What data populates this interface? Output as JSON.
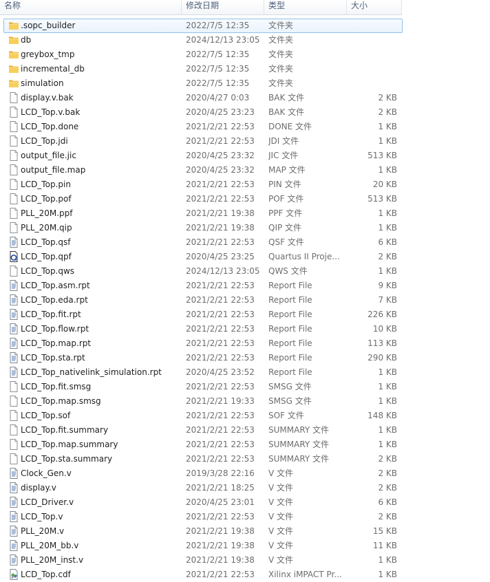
{
  "columns": {
    "name": "名称",
    "date": "修改日期",
    "type": "类型",
    "size": "大小"
  },
  "colors": {
    "folder": "#f2c44b",
    "selected_border": "#8fc0ea",
    "header_text": "#4c607a"
  },
  "files": [
    {
      "name": ".sopc_builder",
      "date": "2022/7/5 12:35",
      "type": "文件夹",
      "size": "",
      "icon": "folder",
      "selected": true
    },
    {
      "name": "db",
      "date": "2024/12/13 23:05",
      "type": "文件夹",
      "size": "",
      "icon": "folder"
    },
    {
      "name": "greybox_tmp",
      "date": "2022/7/5 12:35",
      "type": "文件夹",
      "size": "",
      "icon": "folder"
    },
    {
      "name": "incremental_db",
      "date": "2022/7/5 12:35",
      "type": "文件夹",
      "size": "",
      "icon": "folder"
    },
    {
      "name": "simulation",
      "date": "2022/7/5 12:35",
      "type": "文件夹",
      "size": "",
      "icon": "folder"
    },
    {
      "name": "display.v.bak",
      "date": "2020/4/27 0:03",
      "type": "BAK 文件",
      "size": "2 KB",
      "icon": "file"
    },
    {
      "name": "LCD_Top.v.bak",
      "date": "2020/4/25 23:23",
      "type": "BAK 文件",
      "size": "2 KB",
      "icon": "file"
    },
    {
      "name": "LCD_Top.done",
      "date": "2021/2/21 22:53",
      "type": "DONE 文件",
      "size": "1 KB",
      "icon": "file"
    },
    {
      "name": "LCD_Top.jdi",
      "date": "2021/2/21 22:53",
      "type": "JDI 文件",
      "size": "1 KB",
      "icon": "file"
    },
    {
      "name": "output_file.jic",
      "date": "2020/4/25 23:32",
      "type": "JIC 文件",
      "size": "513 KB",
      "icon": "file"
    },
    {
      "name": "output_file.map",
      "date": "2020/4/25 23:32",
      "type": "MAP 文件",
      "size": "1 KB",
      "icon": "file"
    },
    {
      "name": "LCD_Top.pin",
      "date": "2021/2/21 22:53",
      "type": "PIN 文件",
      "size": "20 KB",
      "icon": "file"
    },
    {
      "name": "LCD_Top.pof",
      "date": "2021/2/21 22:53",
      "type": "POF 文件",
      "size": "513 KB",
      "icon": "file"
    },
    {
      "name": "PLL_20M.ppf",
      "date": "2021/2/21 19:38",
      "type": "PPF 文件",
      "size": "1 KB",
      "icon": "file"
    },
    {
      "name": "PLL_20M.qip",
      "date": "2021/2/21 19:38",
      "type": "QIP 文件",
      "size": "1 KB",
      "icon": "file"
    },
    {
      "name": "LCD_Top.qsf",
      "date": "2021/2/21 22:53",
      "type": "QSF 文件",
      "size": "6 KB",
      "icon": "text"
    },
    {
      "name": "LCD_Top.qpf",
      "date": "2020/4/25 23:25",
      "type": "Quartus II Proje...",
      "size": "2 KB",
      "icon": "quartus"
    },
    {
      "name": "LCD_Top.qws",
      "date": "2024/12/13 23:05",
      "type": "QWS 文件",
      "size": "1 KB",
      "icon": "file"
    },
    {
      "name": "LCD_Top.asm.rpt",
      "date": "2021/2/21 22:53",
      "type": "Report File",
      "size": "9 KB",
      "icon": "text"
    },
    {
      "name": "LCD_Top.eda.rpt",
      "date": "2021/2/21 22:53",
      "type": "Report File",
      "size": "7 KB",
      "icon": "text"
    },
    {
      "name": "LCD_Top.fit.rpt",
      "date": "2021/2/21 22:53",
      "type": "Report File",
      "size": "226 KB",
      "icon": "text"
    },
    {
      "name": "LCD_Top.flow.rpt",
      "date": "2021/2/21 22:53",
      "type": "Report File",
      "size": "10 KB",
      "icon": "text"
    },
    {
      "name": "LCD_Top.map.rpt",
      "date": "2021/2/21 22:53",
      "type": "Report File",
      "size": "113 KB",
      "icon": "text"
    },
    {
      "name": "LCD_Top.sta.rpt",
      "date": "2021/2/21 22:53",
      "type": "Report File",
      "size": "290 KB",
      "icon": "text"
    },
    {
      "name": "LCD_Top_nativelink_simulation.rpt",
      "date": "2020/4/25 23:52",
      "type": "Report File",
      "size": "1 KB",
      "icon": "text"
    },
    {
      "name": "LCD_Top.fit.smsg",
      "date": "2021/2/21 22:53",
      "type": "SMSG 文件",
      "size": "1 KB",
      "icon": "file"
    },
    {
      "name": "LCD_Top.map.smsg",
      "date": "2021/2/21 19:33",
      "type": "SMSG 文件",
      "size": "1 KB",
      "icon": "file"
    },
    {
      "name": "LCD_Top.sof",
      "date": "2021/2/21 22:53",
      "type": "SOF 文件",
      "size": "148 KB",
      "icon": "file"
    },
    {
      "name": "LCD_Top.fit.summary",
      "date": "2021/2/21 22:53",
      "type": "SUMMARY 文件",
      "size": "1 KB",
      "icon": "file"
    },
    {
      "name": "LCD_Top.map.summary",
      "date": "2021/2/21 22:53",
      "type": "SUMMARY 文件",
      "size": "1 KB",
      "icon": "file"
    },
    {
      "name": "LCD_Top.sta.summary",
      "date": "2021/2/21 22:53",
      "type": "SUMMARY 文件",
      "size": "2 KB",
      "icon": "file"
    },
    {
      "name": "Clock_Gen.v",
      "date": "2019/3/28 22:16",
      "type": "V 文件",
      "size": "2 KB",
      "icon": "text"
    },
    {
      "name": "display.v",
      "date": "2021/2/21 18:25",
      "type": "V 文件",
      "size": "2 KB",
      "icon": "text"
    },
    {
      "name": "LCD_Driver.v",
      "date": "2020/4/25 23:01",
      "type": "V 文件",
      "size": "6 KB",
      "icon": "text"
    },
    {
      "name": "LCD_Top.v",
      "date": "2021/2/21 22:53",
      "type": "V 文件",
      "size": "2 KB",
      "icon": "text"
    },
    {
      "name": "PLL_20M.v",
      "date": "2021/2/21 19:38",
      "type": "V 文件",
      "size": "15 KB",
      "icon": "text"
    },
    {
      "name": "PLL_20M_bb.v",
      "date": "2021/2/21 19:38",
      "type": "V 文件",
      "size": "11 KB",
      "icon": "text"
    },
    {
      "name": "PLL_20M_inst.v",
      "date": "2021/2/21 19:38",
      "type": "V 文件",
      "size": "1 KB",
      "icon": "text"
    },
    {
      "name": "LCD_Top.cdf",
      "date": "2021/2/21 22:53",
      "type": "Xilinx iMPACT Pr...",
      "size": "1 KB",
      "icon": "impact"
    }
  ]
}
